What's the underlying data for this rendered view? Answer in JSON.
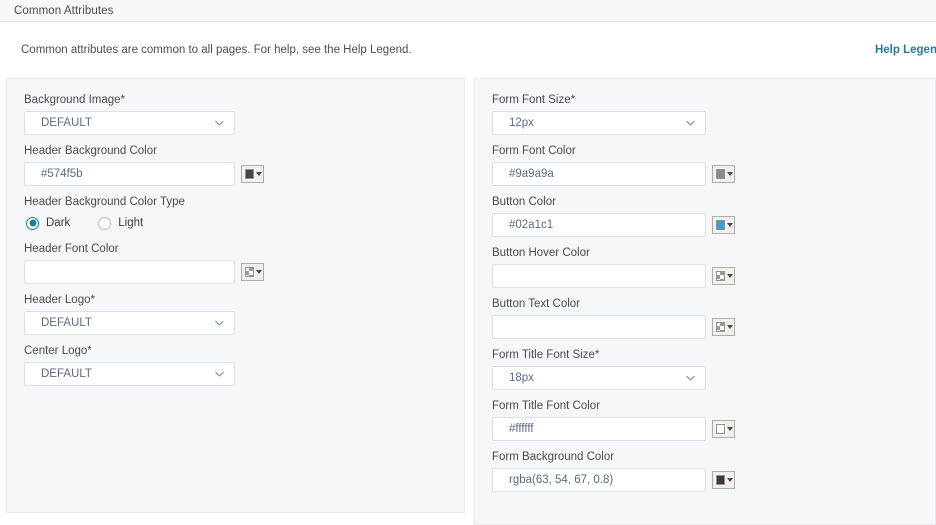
{
  "section": {
    "title": "Common Attributes"
  },
  "description": {
    "text": "Common attributes are common to all pages. For help, see the Help Legend.",
    "help_link_label": "Help Legend",
    "help_link_color": "#2a7b96"
  },
  "left_panel": {
    "fields": [
      {
        "label": "Background Image*",
        "type": "select",
        "value": "DEFAULT"
      },
      {
        "label": "Header Background Color",
        "type": "color",
        "value": "#574f5b",
        "swatch_color": "#4a434f",
        "swatch_empty": false
      },
      {
        "label": "Header Background Color Type",
        "type": "radio",
        "options": [
          {
            "label": "Dark",
            "selected": true
          },
          {
            "label": "Light",
            "selected": false
          }
        ]
      },
      {
        "label": "Header Font Color",
        "type": "color",
        "value": "",
        "swatch_color": "",
        "swatch_empty": true
      },
      {
        "label": "Header Logo*",
        "type": "select",
        "value": "DEFAULT"
      },
      {
        "label": "Center Logo*",
        "type": "select",
        "value": "DEFAULT"
      }
    ]
  },
  "right_panel": {
    "fields": [
      {
        "label": "Form Font Size*",
        "type": "select",
        "value": "12px"
      },
      {
        "label": "Form Font Color",
        "type": "color",
        "value": "#9a9a9a",
        "swatch_color": "#8b8b8b",
        "swatch_empty": false
      },
      {
        "label": "Button Color",
        "type": "color",
        "value": "#02a1c1",
        "swatch_color": "#2fa8c6",
        "swatch_empty": false
      },
      {
        "label": "Button Hover Color",
        "type": "color",
        "value": "",
        "swatch_color": "",
        "swatch_empty": true
      },
      {
        "label": "Button Text Color",
        "type": "color",
        "value": "",
        "swatch_color": "",
        "swatch_empty": true
      },
      {
        "label": "Form Title Font Size*",
        "type": "select",
        "value": "18px"
      },
      {
        "label": "Form Title Font Color",
        "type": "color",
        "value": "#ffffff",
        "swatch_color": "#ffffff",
        "swatch_empty": false
      },
      {
        "label": "Form Background Color",
        "type": "color",
        "value": "rgba(63, 54, 67, 0.8)",
        "swatch_color": "#3f3643",
        "swatch_empty": false
      }
    ]
  },
  "icons": {
    "chevron": "chevron-down-icon",
    "swatch_arrow": "dropdown-arrow-icon"
  }
}
